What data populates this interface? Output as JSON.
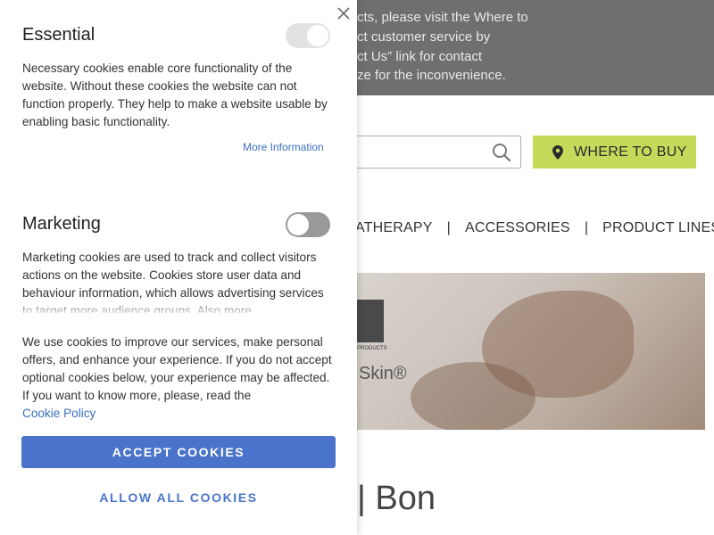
{
  "site": {
    "notice_lines": [
      "cts, please visit the Where to",
      "ct customer service by",
      "ct Us” link for contact",
      "ze for the inconvenience."
    ],
    "where_to_buy": "WHERE TO BUY",
    "nav": [
      "ATHERAPY",
      "|",
      "ACCESSORIES",
      "|",
      "PRODUCT LINES"
    ],
    "hero_skin": "Skin®",
    "hero_products": "PRODUCTS",
    "big_title": "| Bon"
  },
  "consent": {
    "essential": {
      "title": "Essential",
      "toggle_on": true,
      "text": "Necessary cookies enable core functionality of the website. Without these cookies the website can not function properly. They help to make a website usable by enabling basic functionality.",
      "more_info": "More Information"
    },
    "marketing": {
      "title": "Marketing",
      "toggle_on": false,
      "text": "Marketing cookies are used to track and collect visitors actions on the website. Cookies store user data and behaviour information, which allows advertising services to target more audience groups. Also more"
    },
    "footer_text": "We use cookies to improve our services, make personal offers, and enhance your experience. If you do not accept optional cookies below, your experience may be affected. If you want to know more, please, read the",
    "cookie_policy": "Cookie Policy",
    "accept_label": "ACCEPT COOKIES",
    "allow_all_label": "ALLOW ALL COOKIES"
  },
  "colors": {
    "accent": "#4a74c9",
    "buy_button": "#c6d95a",
    "notice_bar": "#6f6f6f"
  }
}
